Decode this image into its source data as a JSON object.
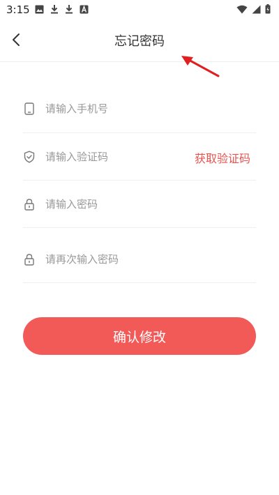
{
  "status_bar": {
    "time": "3:15",
    "left_icons": [
      "image-icon",
      "download-icon",
      "download-icon",
      "a-notification-icon"
    ],
    "right_icons": [
      "wifi-icon",
      "signal-icon",
      "battery-icon"
    ]
  },
  "header": {
    "title": "忘记密码",
    "back_icon": "chevron-left-icon"
  },
  "form": {
    "phone": {
      "placeholder": "请输入手机号",
      "icon": "phone-icon"
    },
    "verify_code": {
      "placeholder": "请输入验证码",
      "icon": "shield-icon",
      "button_label": "获取验证码"
    },
    "password": {
      "placeholder": "请输入密码",
      "icon": "lock-icon"
    },
    "password_confirm": {
      "placeholder": "请再次输入密码",
      "icon": "lock-icon"
    }
  },
  "submit": {
    "label": "确认修改"
  },
  "colors": {
    "accent": "#f25a58",
    "code_link": "#e65450",
    "placeholder": "#999999",
    "divider": "#eeeeee",
    "annotation_arrow": "#e02020"
  }
}
